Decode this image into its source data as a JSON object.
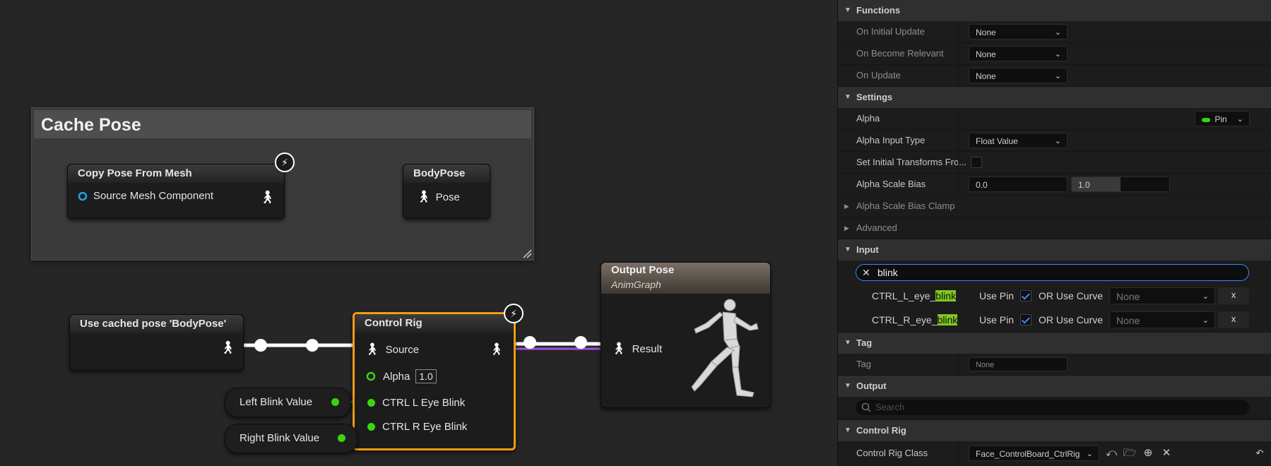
{
  "graph": {
    "comment": {
      "title": "Cache Pose"
    },
    "copy_pose_node": {
      "title": "Copy Pose From Mesh",
      "pin_label": "Source Mesh Component"
    },
    "body_pose_node": {
      "title": "BodyPose",
      "pin_label": "Pose"
    },
    "cached_pose_node": {
      "title": "Use cached pose 'BodyPose'"
    },
    "control_rig_node": {
      "title": "Control Rig",
      "source_label": "Source",
      "alpha_label": "Alpha",
      "alpha_value": "1.0",
      "pin_l": "CTRL L Eye Blink",
      "pin_r": "CTRL R Eye Blink"
    },
    "left_blink": {
      "label": "Left Blink Value"
    },
    "right_blink": {
      "label": "Right Blink Value"
    },
    "output_pose_node": {
      "title": "Output Pose",
      "subtitle": "AnimGraph",
      "result_label": "Result"
    },
    "colors": {
      "exec_wire": "#ffffff",
      "float_pin": "#39d50f",
      "selected_outline": "#f39c12",
      "purple_wire": "#a64de0"
    }
  },
  "panel": {
    "functions": {
      "title": "Functions",
      "rows": [
        {
          "label": "On Initial Update",
          "value": "None"
        },
        {
          "label": "On Become Relevant",
          "value": "None"
        },
        {
          "label": "On Update",
          "value": "None"
        }
      ]
    },
    "settings": {
      "title": "Settings",
      "alpha_label": "Alpha",
      "alpha_pin_label": "Pin",
      "alpha_input_type_label": "Alpha Input Type",
      "alpha_input_type_value": "Float Value",
      "set_initial_label": "Set Initial Transforms Fro...",
      "alpha_scale_bias_label": "Alpha Scale Bias",
      "alpha_scale_bias_min": "0.0",
      "alpha_scale_bias_max": "1.0",
      "alpha_scale_bias_clamp_label": "Alpha Scale Bias Clamp",
      "advanced_label": "Advanced"
    },
    "input": {
      "title": "Input",
      "search_value": "blink",
      "rows": [
        {
          "prefix": "CTRL_L_eye_",
          "highlight": "blink",
          "use_pin": "Use Pin",
          "or_use_curve": "OR Use Curve",
          "curve_value": "None",
          "clear": "x"
        },
        {
          "prefix": "CTRL_R_eye_",
          "highlight": "blink",
          "use_pin": "Use Pin",
          "or_use_curve": "OR Use Curve",
          "curve_value": "None",
          "clear": "x"
        }
      ]
    },
    "tag": {
      "title": "Tag",
      "label": "Tag",
      "value": "None"
    },
    "output": {
      "title": "Output",
      "search_placeholder": "Search"
    },
    "control_rig": {
      "title": "Control Rig",
      "class_label": "Control Rig Class",
      "class_value": "Face_ControlBoard_CtrlRig"
    }
  }
}
